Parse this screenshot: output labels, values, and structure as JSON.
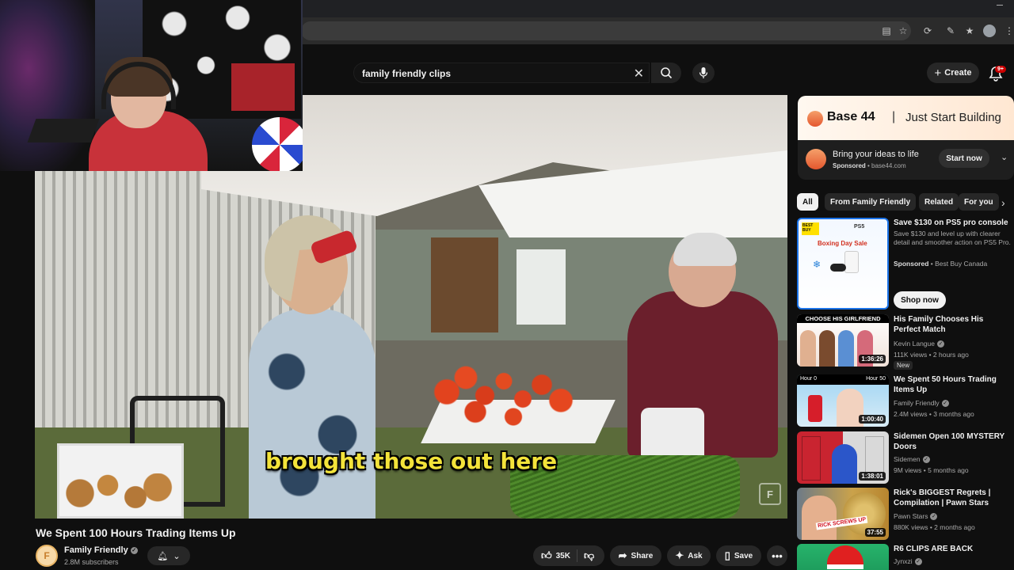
{
  "search": {
    "query": "family friendly clips"
  },
  "header": {
    "create_label": "Create",
    "notification_badge": "9+"
  },
  "video": {
    "caption": "brought those out here",
    "title": "We Spent 100 Hours Trading Items Up",
    "channel": "Family Friendly",
    "subscribers": "2.8M subscribers",
    "likes": "35K",
    "share_label": "Share",
    "ask_label": "Ask",
    "save_label": "Save"
  },
  "ad": {
    "brand": "Base 44",
    "tagline": "Just Start Building",
    "headline": "Bring your ideas to life",
    "sponsored": "Sponsored",
    "domain": "base44.com",
    "cta": "Start now"
  },
  "chips": [
    "All",
    "From Family Friendly",
    "Related",
    "For you"
  ],
  "recommendations": [
    {
      "title": "Save $130 on PS5 pro console",
      "description": "Save $130 and level up with clearer detail and smoother action on PS5 Pro.",
      "sponsored": "Sponsored",
      "advertiser": "Best Buy Canada",
      "cta": "Shop now",
      "thumb_text": {
        "badge": "BEST BUY",
        "brand": "PS5",
        "sale": "Boxing Day Sale"
      }
    },
    {
      "title": "His Family Chooses His Perfect Match",
      "channel": "Kevin Langue",
      "meta": "111K views • 2 hours ago",
      "badge": "New",
      "duration": "1:36:26",
      "thumb_text": "CHOOSE HIS GIRLFRIEND"
    },
    {
      "title": "We Spent 50 Hours Trading Items Up",
      "channel": "Family Friendly",
      "meta": "2.4M views • 3 months ago",
      "duration": "1:00:40",
      "thumb_text": {
        "left": "Hour 0",
        "right": "Hour 50"
      }
    },
    {
      "title": "Sidemen Open 100 MYSTERY Doors",
      "channel": "Sidemen",
      "meta": "9M views • 5 months ago",
      "duration": "1:38:01"
    },
    {
      "title": "Rick's BIGGEST Regrets | Compilation | Pawn Stars",
      "channel": "Pawn Stars",
      "meta": "880K views • 2 months ago",
      "duration": "37:55",
      "thumb_text": "RICK SCREWS UP"
    },
    {
      "title": "R6 CLIPS ARE BACK",
      "channel": "Jynxzi"
    }
  ],
  "icons": {
    "search": "search-icon",
    "clear": "close-icon",
    "mic": "microphone-icon",
    "create": "plus-icon",
    "bell": "bell-icon",
    "like": "thumbs-up-icon",
    "dislike": "thumbs-down-icon",
    "share": "share-arrow-icon",
    "ask": "sparkle-icon",
    "save": "bookmark-icon",
    "more": "more-horizontal-icon"
  },
  "colors": {
    "background": "#0f0f0f",
    "caption": "#f3e33a",
    "notification": "#cc0000",
    "ad_accent": "#e4572e"
  }
}
